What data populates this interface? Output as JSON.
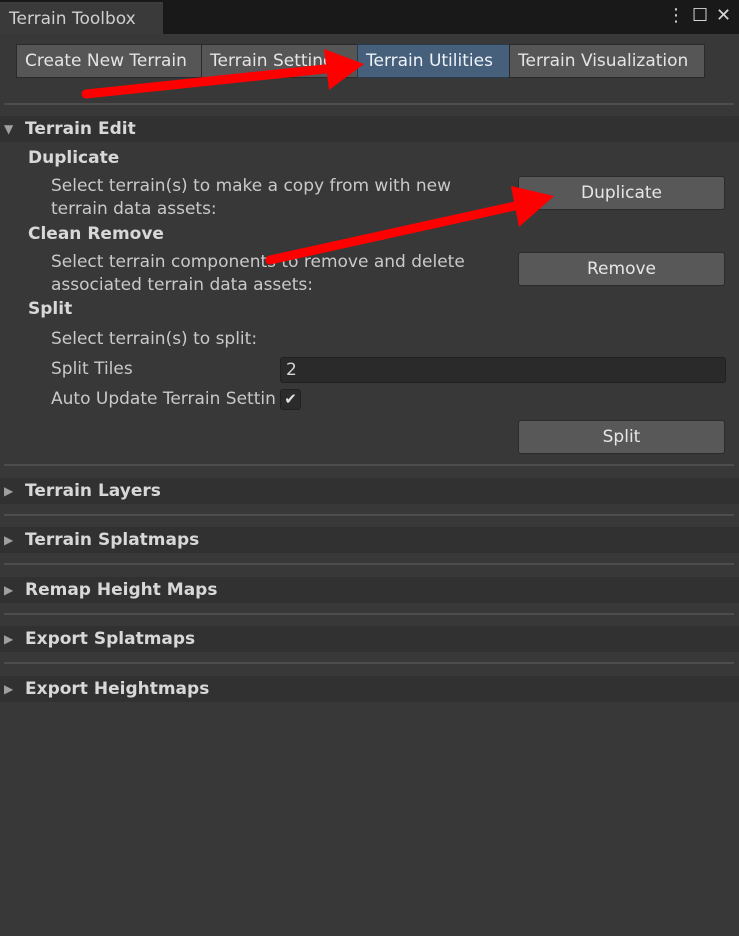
{
  "window": {
    "title": "Terrain Toolbox",
    "menu_icon": "⋮",
    "maximize_icon": "☐",
    "close_icon": "✕"
  },
  "tabs": [
    {
      "label": "Create New Terrain",
      "active": false
    },
    {
      "label": "Terrain Settings",
      "active": false
    },
    {
      "label": "Terrain Utilities",
      "active": true
    },
    {
      "label": "Terrain Visualization",
      "active": false
    }
  ],
  "terrain_edit": {
    "label": "Terrain Edit",
    "expanded": true,
    "duplicate": {
      "heading": "Duplicate",
      "description_line1": "Select terrain(s) to make a copy from with new",
      "description_line2": "terrain data assets:",
      "button": "Duplicate"
    },
    "clean_remove": {
      "heading": "Clean Remove",
      "description_line1": "Select terrain components to remove and delete",
      "description_line2": "associated terrain data assets:",
      "button": "Remove"
    },
    "split": {
      "heading": "Split",
      "description": "Select terrain(s) to split:",
      "tiles_label": "Split Tiles",
      "tiles_value": "2",
      "auto_update_label": "Auto Update Terrain Settin",
      "auto_update_checked": true,
      "button": "Split"
    }
  },
  "sections": [
    {
      "label": "Terrain Layers",
      "expanded": false
    },
    {
      "label": "Terrain Splatmaps",
      "expanded": false
    },
    {
      "label": "Remap Height Maps",
      "expanded": false
    },
    {
      "label": "Export Splatmaps",
      "expanded": false
    },
    {
      "label": "Export Heightmaps",
      "expanded": false
    }
  ],
  "icons": {
    "expanded_arrow": "▼",
    "collapsed_arrow": "▶",
    "check": "✔"
  },
  "colors": {
    "background": "#383838",
    "active_tab": "#46607c",
    "annotation_arrow": "#ff0000"
  }
}
